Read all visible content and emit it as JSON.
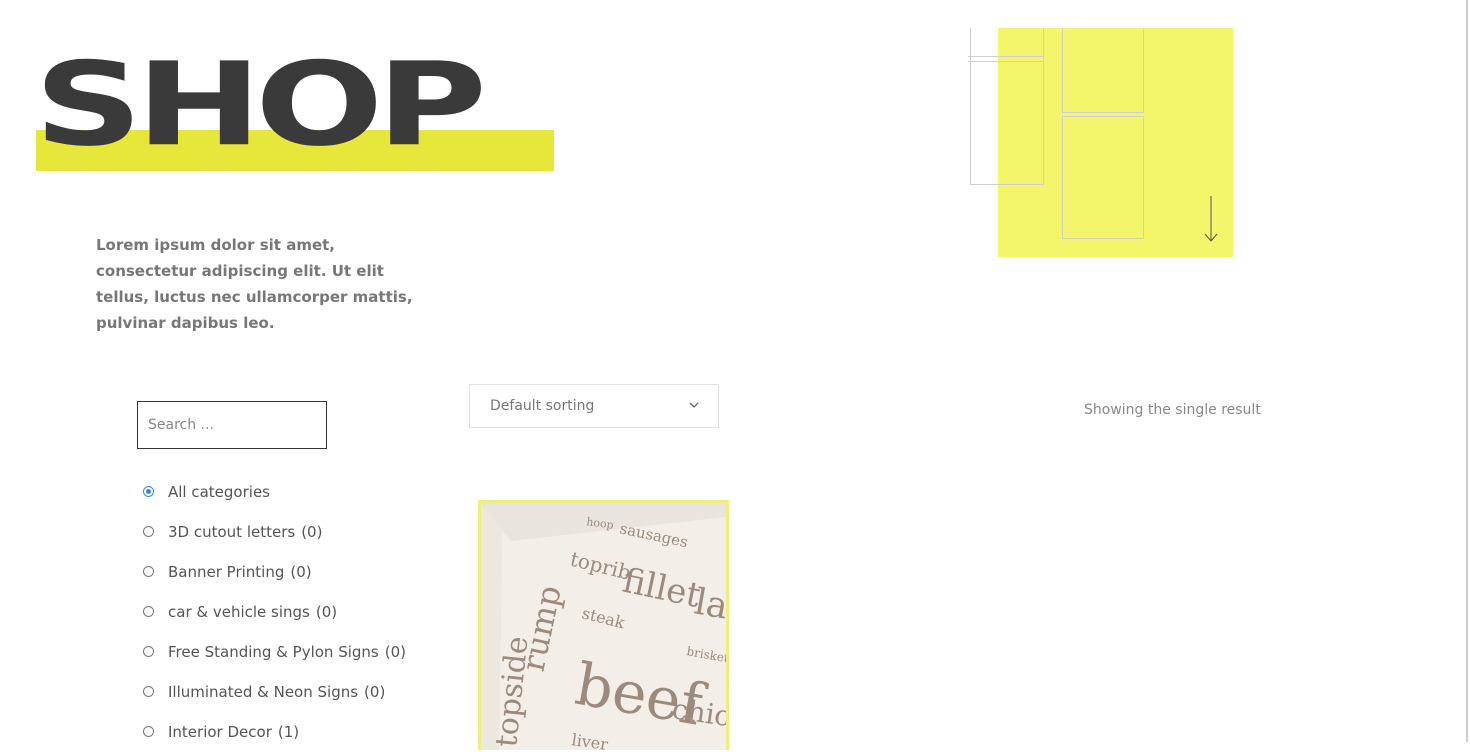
{
  "header": {
    "title": "SHOP",
    "intro": "Lorem ipsum dolor sit amet, consectetur adipiscing elit. Ut elit tellus, luctus nec ullamcorper mattis, pulvinar dapibus leo."
  },
  "search": {
    "placeholder": "Search ...",
    "value": ""
  },
  "sorting": {
    "selected": "Default sorting"
  },
  "results": {
    "text": "Showing the single result"
  },
  "categories": [
    {
      "label": "All categories",
      "count": "",
      "checked": true
    },
    {
      "label": "3D cutout letters",
      "count": "(0)",
      "checked": false
    },
    {
      "label": "Banner Printing",
      "count": "(0)",
      "checked": false
    },
    {
      "label": "car & vehicle sings",
      "count": "(0)",
      "checked": false
    },
    {
      "label": "Free Standing & Pylon Signs",
      "count": "(0)",
      "checked": false
    },
    {
      "label": "Illuminated & Neon Signs",
      "count": "(0)",
      "checked": false
    },
    {
      "label": "Interior Decor",
      "count": "(1)",
      "checked": false
    }
  ],
  "product": {
    "image_words": [
      "topside",
      "sausages",
      "toprib",
      "fillet",
      "lamb",
      "steak",
      "rump",
      "beef",
      "chick",
      "brisket",
      "liver",
      "hoop"
    ]
  },
  "colors": {
    "accent_yellow": "#e6e63b",
    "panel_yellow": "#f3f56a",
    "title_dark": "#3a3a3a",
    "radio_blue": "#3b87d8"
  },
  "icons": {
    "scroll": "arrow-down-icon",
    "sort": "chevron-down-icon"
  }
}
